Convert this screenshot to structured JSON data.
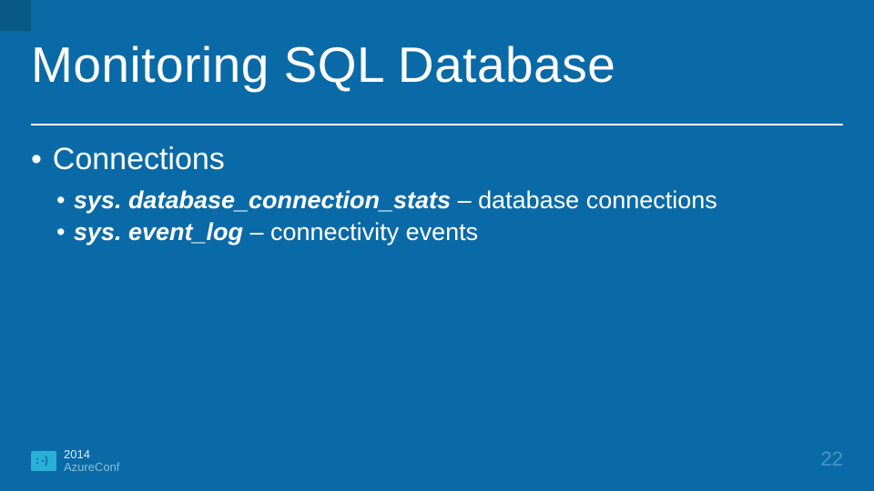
{
  "title": "Monitoring SQL Database",
  "content": {
    "heading": "Connections",
    "items": [
      {
        "term": "sys. database_connection_stats",
        "desc": " – database connections"
      },
      {
        "term": "sys. event_log",
        "desc": " – connectivity events"
      }
    ]
  },
  "footer": {
    "year": "2014",
    "conf": "AzureConf",
    "face": ": -)"
  },
  "page_number": "22"
}
